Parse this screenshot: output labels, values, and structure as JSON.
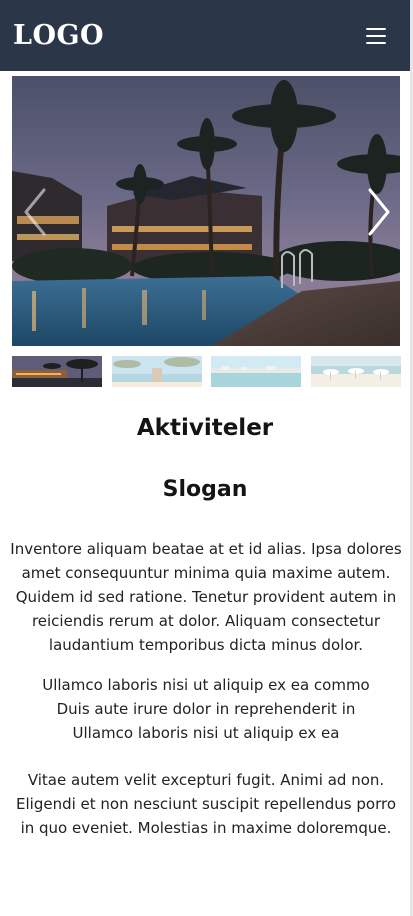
{
  "header": {
    "logo_text": "LOGO",
    "background_color": "#2b3649",
    "menu_icon": "hamburger-menu-icon"
  },
  "slider": {
    "prev_icon": "chevron-left-icon",
    "next_icon": "chevron-right-icon",
    "thumbnails": [
      {
        "name": "resort-pool-night"
      },
      {
        "name": "beach-pier"
      },
      {
        "name": "coastal-town"
      },
      {
        "name": "beach-umbrellas"
      }
    ]
  },
  "content": {
    "title": "Aktiviteler",
    "slogan": "Slogan",
    "paragraph1": "Inventore aliquam beatae at et id alias. Ipsa dolores amet consequuntur minima quia maxime autem. Quidem id sed ratione. Tenetur provident autem in reiciendis rerum at dolor. Aliquam consectetur laudantium temporibus dicta minus dolor.",
    "paragraph2_lines": [
      "Ullamco laboris nisi ut aliquip ex ea commo",
      "Duis aute irure dolor in reprehenderit in",
      "Ullamco laboris nisi ut aliquip ex ea"
    ],
    "paragraph3": "Vitae autem velit excepturi fugit. Animi ad non. Eligendi et non nesciunt suscipit repellendus porro in quo eveniet. Molestias in maxime doloremque."
  }
}
